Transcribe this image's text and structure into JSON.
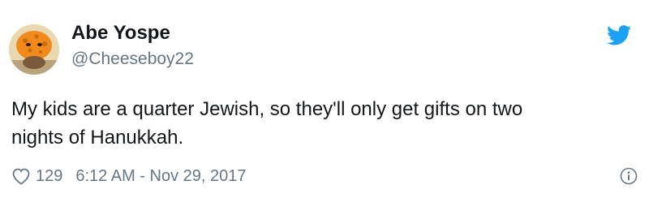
{
  "user": {
    "name": "Abe Yospe",
    "handle": "@Cheeseboy22"
  },
  "tweet": {
    "text": "My kids are a quarter Jewish, so they'll only get gifts on two\nnights of Hanukkah.",
    "like_count": "129",
    "timestamp": "6:12 AM - Nov 29, 2017"
  },
  "icons": {
    "brand": "twitter-bird-icon",
    "like": "heart-outline-icon",
    "info": "info-circle-icon"
  },
  "colors": {
    "brand": "#1da1f2",
    "text": "#14171a",
    "secondary": "#657786",
    "avatar_orange": "#f08a1c"
  }
}
